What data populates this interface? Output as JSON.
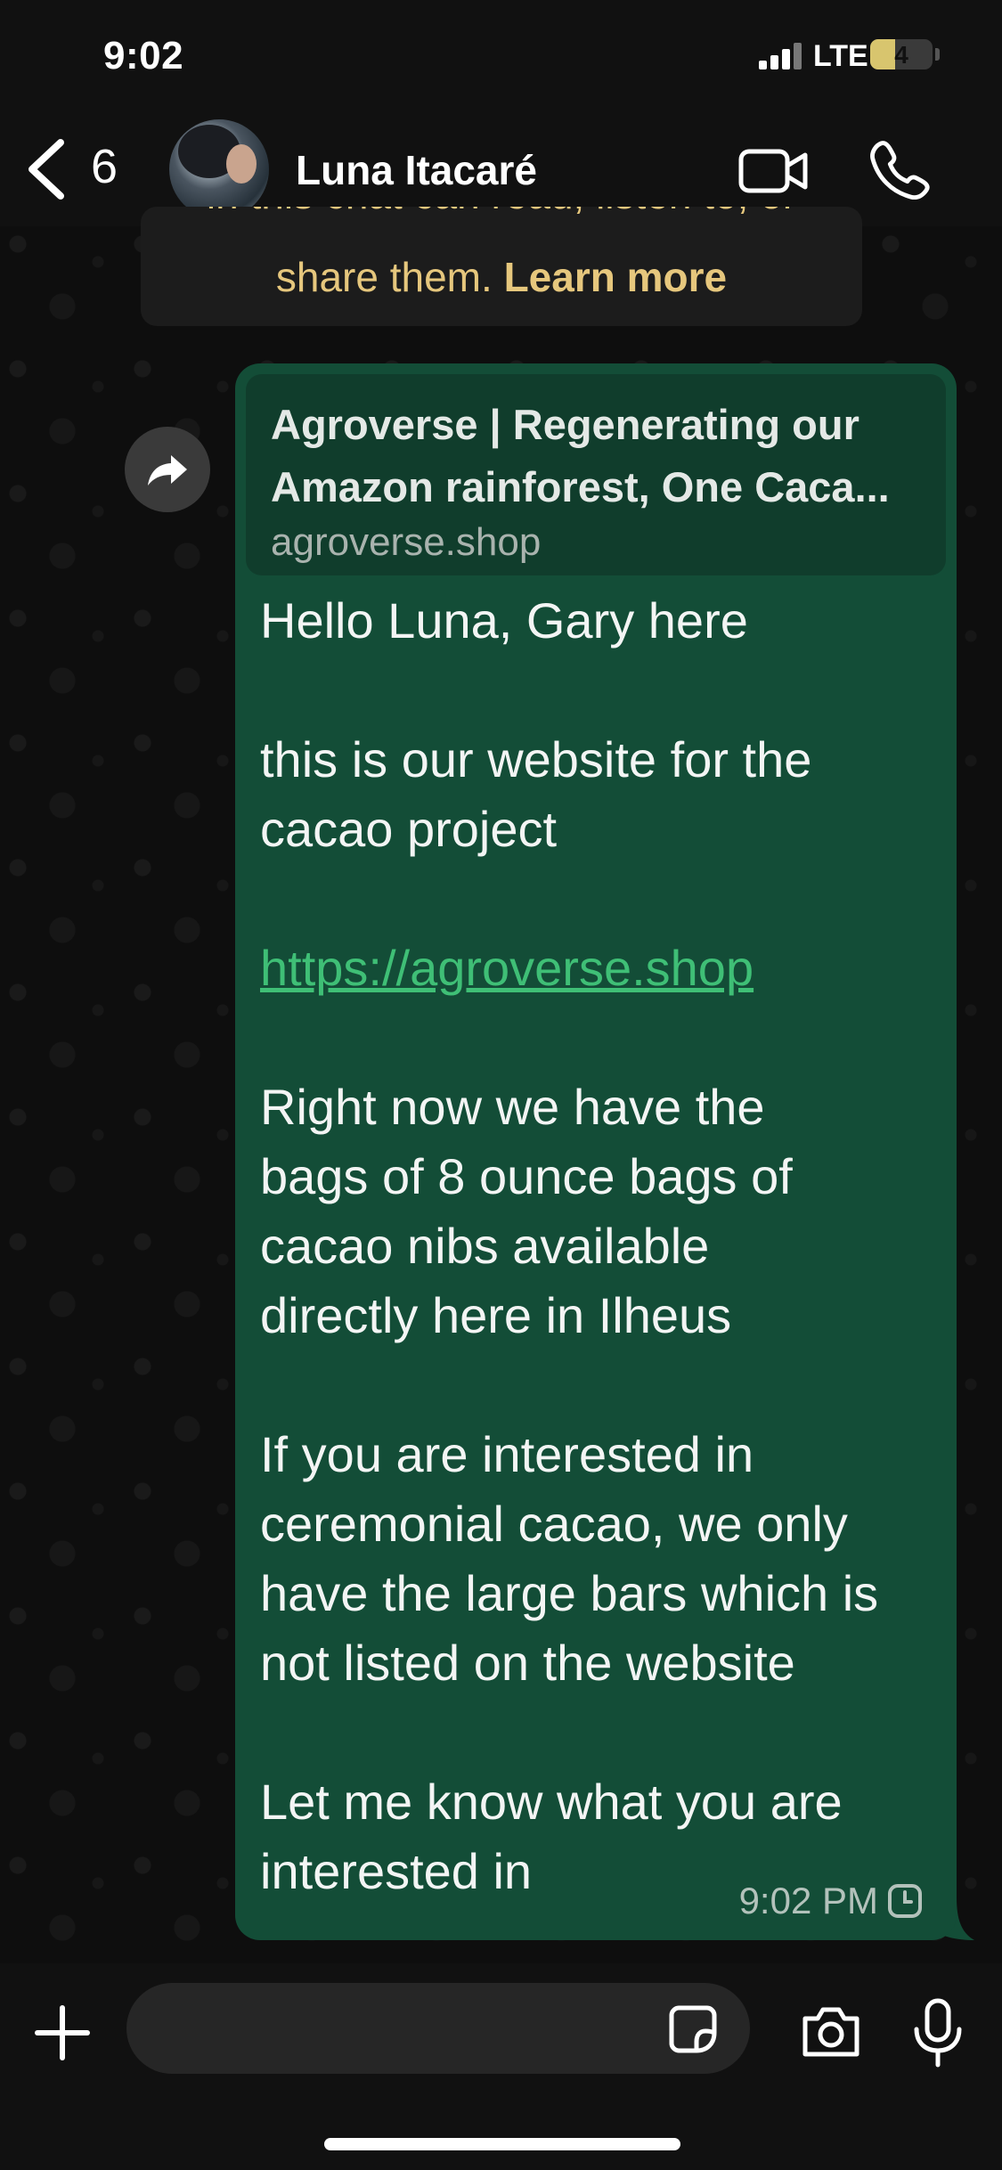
{
  "status_bar": {
    "time": "9:02",
    "network": "LTE",
    "battery": "4"
  },
  "nav": {
    "unread_count": "6",
    "contact_name": "Luna Itacaré"
  },
  "notice": {
    "cut_text": "in this chat can read, listen to, or",
    "text": "share them.",
    "link": "Learn more"
  },
  "message": {
    "preview_title_line1": "Agroverse | Regenerating our",
    "preview_title_line2": "Amazon rainforest, One Caca...",
    "preview_domain": "agroverse.shop",
    "lines": {
      "l1": "Hello Luna, Gary here",
      "l2": "this is our website for the",
      "l3": "cacao project",
      "link": "https://agroverse.shop",
      "l5": "Right now we have the",
      "l6": "bags of 8 ounce bags of",
      "l7": "cacao nibs available",
      "l8": "directly here in Ilheus",
      "l9": "If you are interested in",
      "l10": "ceremonial cacao, we only",
      "l11": "have the large bars which is",
      "l12": "not listed on the website",
      "l13": "Let me know what you are",
      "l14": "interested in"
    },
    "time": "9:02 PM",
    "status_icon": "clock-pending-icon"
  },
  "composer": {
    "input_value": "",
    "placeholder": ""
  },
  "colors": {
    "bubble": "#134d37",
    "link": "#3fbf76",
    "notice_text": "#e6c77d"
  }
}
